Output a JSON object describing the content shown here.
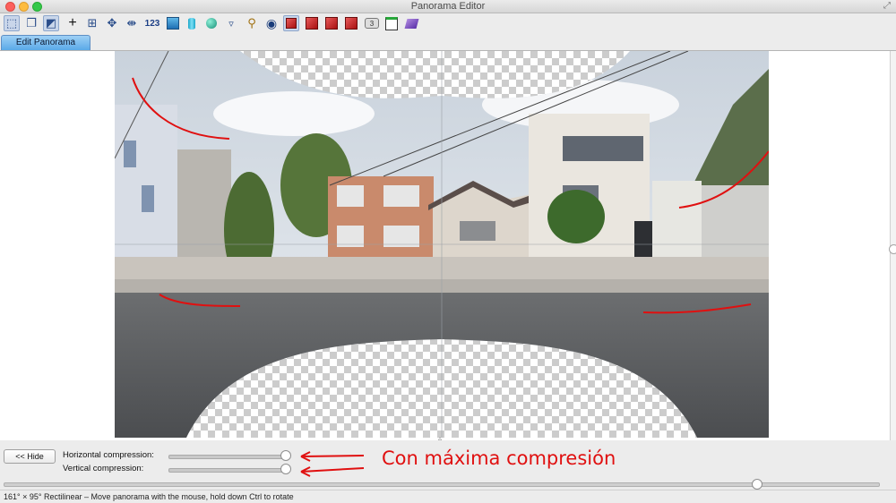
{
  "window": {
    "title": "Panorama Editor"
  },
  "toolbar": {
    "items": [
      {
        "name": "select-tool-icon",
        "glyph": "⬚",
        "active": true
      },
      {
        "name": "layers-icon",
        "glyph": "❏"
      },
      {
        "name": "crop-icon",
        "glyph": "⬚",
        "active": true
      },
      {
        "name": "crosshair-icon",
        "glyph": "+"
      },
      {
        "name": "center-icon",
        "glyph": "⊕"
      },
      {
        "name": "move-icon",
        "glyph": "✥"
      },
      {
        "name": "fit-icon",
        "glyph": "⇹"
      },
      {
        "name": "numbers-icon",
        "text": "123"
      },
      {
        "name": "rectilinear-icon"
      },
      {
        "name": "cylinder-icon"
      },
      {
        "name": "sphere-icon"
      },
      {
        "name": "triangle-icon",
        "glyph": "▿"
      },
      {
        "name": "zoom-icon",
        "glyph": "🔍"
      },
      {
        "name": "preview-eye-icon",
        "glyph": "👁"
      },
      {
        "name": "red-frame-icon"
      },
      {
        "name": "red-box-icon-1"
      },
      {
        "name": "red-box-icon-2"
      },
      {
        "name": "red-box-icon-3"
      },
      {
        "name": "badge-3-icon",
        "text": "3"
      },
      {
        "name": "window-icon"
      },
      {
        "name": "books-icon"
      }
    ]
  },
  "tabs": [
    {
      "label": "Edit Panorama",
      "active": true
    }
  ],
  "controls": {
    "hide_label": "<< Hide",
    "horizontal_label": "Horizontal compression:",
    "vertical_label": "Vertical compression:",
    "horizontal_value": 1.0,
    "vertical_value": 1.0,
    "annotation": "Con máxima compresión"
  },
  "status": {
    "text": "161° × 95° Rectilinear – Move panorama with the mouse, hold down Ctrl to rotate"
  },
  "colors": {
    "annotation": "#e01010",
    "tab_active": "#5aa9e8"
  }
}
